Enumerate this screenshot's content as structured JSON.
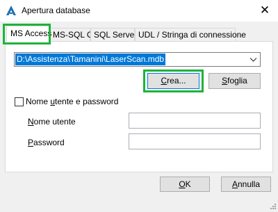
{
  "window": {
    "title": "Apertura database"
  },
  "tabs": [
    "MS Access",
    "MS-SQL CE",
    "SQL Server",
    "UDL / Stringa di connessione"
  ],
  "database_path": "D:\\Assistenza\\Tamanini\\LaserScan.mdb",
  "buttons": {
    "create": {
      "label_accel": "C",
      "label_rest": "rea..."
    },
    "browse": {
      "label_accel": "S",
      "label_rest": "foglia"
    },
    "ok": {
      "label_accel": "O",
      "label_rest": "K"
    },
    "cancel": {
      "label_accel": "A",
      "label_rest": "nnulla"
    }
  },
  "credentials": {
    "checkbox_pre": "Nome ",
    "checkbox_accel": "u",
    "checkbox_post": "tente e password",
    "checked": false,
    "username_accel": "N",
    "username_rest": "ome utente",
    "username_value": "",
    "password_accel": "P",
    "password_rest": "assword",
    "password_value": ""
  },
  "colors": {
    "highlight": "#1db33a",
    "selection": "#0078d7"
  }
}
